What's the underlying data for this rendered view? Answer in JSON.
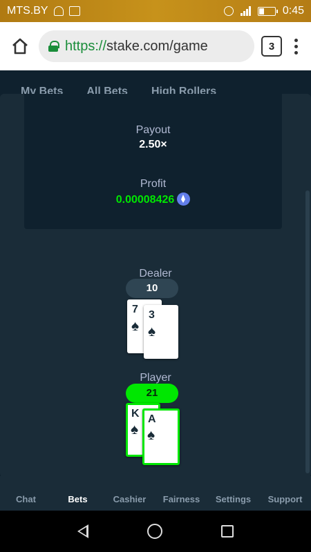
{
  "status_bar": {
    "carrier": "MTS.BY",
    "time": "0:45"
  },
  "browser": {
    "url_scheme": "https://",
    "url_rest": "stake.com/game",
    "tab_count": "3"
  },
  "background_tabs": [
    "My Bets",
    "All Bets",
    "High Rollers"
  ],
  "result": {
    "payout_label": "Payout",
    "payout_value": "2.50×",
    "profit_label": "Profit",
    "profit_value": "0.00008426",
    "currency_icon": "ethereum-icon",
    "colors": {
      "profit": "#00e701"
    }
  },
  "dealer": {
    "label": "Dealer",
    "score": "10",
    "cards": [
      {
        "rank": "7",
        "suit": "♠"
      },
      {
        "rank": "3",
        "suit": "♠"
      }
    ]
  },
  "player": {
    "label": "Player",
    "score": "21",
    "cards": [
      {
        "rank": "K",
        "suit": "♠"
      },
      {
        "rank": "A",
        "suit": "♠"
      }
    ]
  },
  "bottom_nav": [
    "Chat",
    "Bets",
    "Cashier",
    "Fairness",
    "Settings",
    "Support"
  ],
  "active_nav": "Bets",
  "colors": {
    "page_bg": "#0f212e",
    "panel_bg": "#1a2c38",
    "win_green": "#00e701",
    "eth_blue": "#627eea"
  }
}
